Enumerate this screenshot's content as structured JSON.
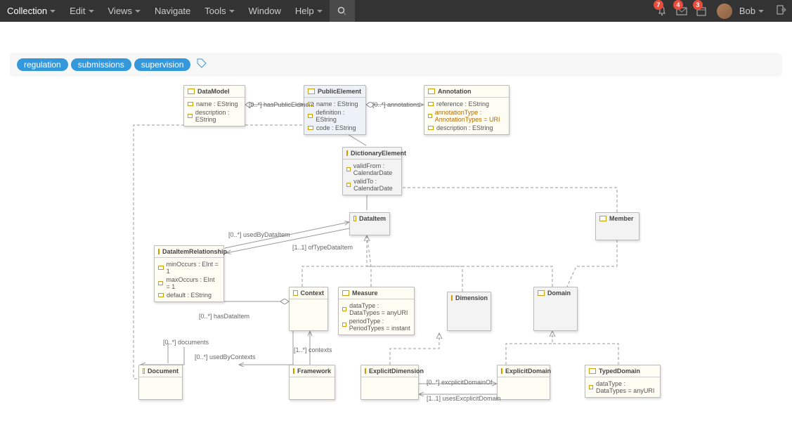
{
  "menu": {
    "collection": "Collection",
    "edit": "Edit",
    "views": "Views",
    "navigate": "Navigate",
    "tools": "Tools",
    "window": "Window",
    "help": "Help"
  },
  "badges": {
    "notif": "7",
    "mail": "4",
    "cal": "3"
  },
  "user": {
    "name": "Bob"
  },
  "tags": [
    "regulation",
    "submissions",
    "supervision"
  ],
  "diagram": {
    "DataModel": {
      "title": "DataModel",
      "attrs": [
        "name : EString",
        "description : EString"
      ]
    },
    "PublicElement": {
      "title": "PublicElement",
      "attrs": [
        "name : EString",
        "definition : EString",
        "code : EString"
      ]
    },
    "Annotation": {
      "title": "Annotation",
      "attrs": [
        "reference : EString",
        "annotationType : AnnotationTypes = URI",
        "description : EString"
      ]
    },
    "DictionaryElement": {
      "title": "DictionaryElement",
      "attrs": [
        "validFrom : CalendarDate",
        "validTo : CalendarDate"
      ]
    },
    "DataItem": {
      "title": "DataItem"
    },
    "Member": {
      "title": "Member"
    },
    "DataItemRelationship": {
      "title": "DataItemRelationship",
      "attrs": [
        "minOccurs : EInt = 1",
        "maxOccurs : EInt = 1",
        "default : EString"
      ]
    },
    "Context": {
      "title": "Context"
    },
    "Measure": {
      "title": "Measure",
      "attrs": [
        "dataType : DataTypes = anyURI",
        "periodType : PeriodTypes = instant"
      ]
    },
    "Dimension": {
      "title": "Dimension"
    },
    "Domain": {
      "title": "Domain"
    },
    "Document": {
      "title": "Document"
    },
    "Framework": {
      "title": "Framework"
    },
    "ExplicitDimension": {
      "title": "ExplicitDimension"
    },
    "ExplicitDomain": {
      "title": "ExplicitDomain"
    },
    "TypedDomain": {
      "title": "TypedDomain",
      "attrs": [
        "dataType : DataTypes = anyURI"
      ]
    }
  },
  "edges": {
    "hasPublicElement": "[0..*] hasPublicElement",
    "annotations": "[0..*] annotations",
    "usedByDataItem": "[0..*] usedByDataItem",
    "ofTypeDataItem": "[1..1] ofTypeDataItem",
    "hasDataItem": "[0..*] hasDataItem",
    "documents": "[0..*] documents",
    "usedByContexts": "[0..*] usedByContexts",
    "contexts": "[1..*] contexts",
    "explicitDomainOf": "[0..*] excplicitDomainOf",
    "usesExplicitDomain": "[1..1] usesExcplicitDomain"
  }
}
